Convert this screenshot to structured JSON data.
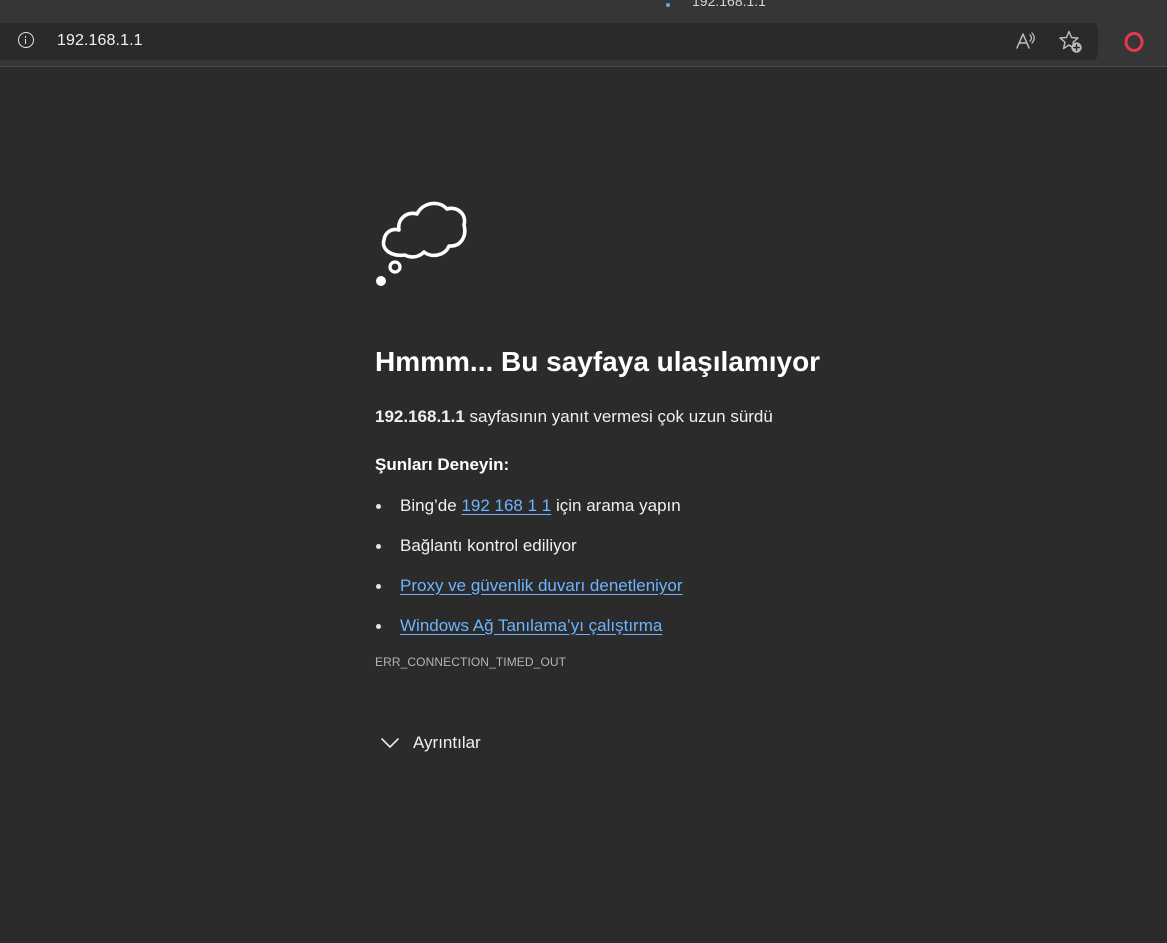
{
  "tab": {
    "title_fragment": "192.168.1.1"
  },
  "address_bar": {
    "url": "192.168.1.1",
    "info_icon": "info-icon",
    "read_aloud_icon": "read-aloud-icon",
    "favorites_icon": "add-favorite-icon",
    "extension_icon": "opera-icon",
    "extension_color": "#e8384f"
  },
  "error_page": {
    "icon": "thought-cloud-icon",
    "heading": "Hmmm... Bu sayfaya ulaşılamıyor",
    "host": "192.168.1.1",
    "description_suffix": " sayfasının yanıt vermesi çok uzun sürdü",
    "try_heading": "Şunları Deneyin:",
    "suggestions": {
      "bing_prefix": "Bing’de ",
      "bing_query": "192 168 1 1",
      "bing_suffix": " için arama yapın",
      "check_connection": "Bağlantı kontrol ediliyor",
      "proxy_firewall": "Proxy ve güvenlik duvarı denetleniyor",
      "network_diagnostics": "Windows Ağ Tanılama’yı çalıştırma"
    },
    "error_code": "ERR_CONNECTION_TIMED_OUT",
    "details_label": "Ayrıntılar",
    "link_color": "#6cb4ff"
  }
}
